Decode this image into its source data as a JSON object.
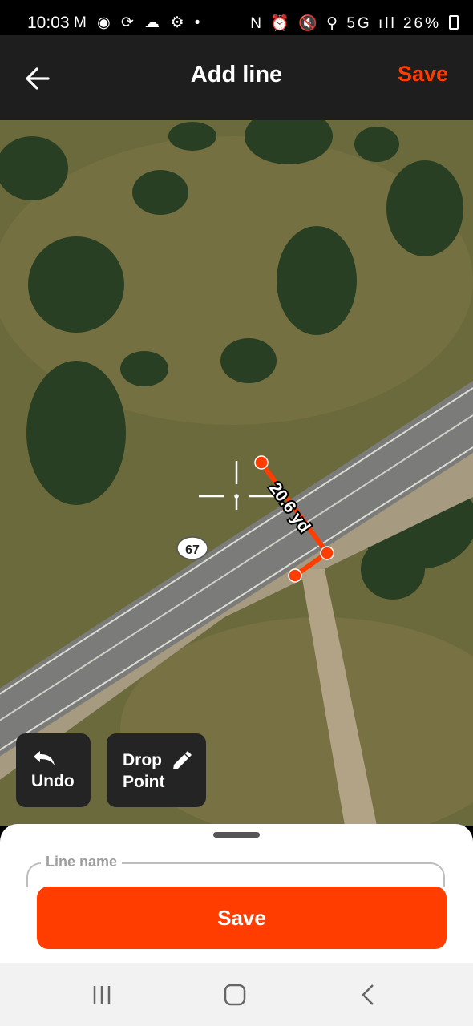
{
  "status_bar": {
    "time": "10:03",
    "notif_icons": "M ◉ ⟳ ☁ ⚙ •",
    "right_icons": "N ⏰ 🔇 ⚲ 5G ıll",
    "battery": "26%"
  },
  "header": {
    "title": "Add line",
    "save_label": "Save",
    "back_icon": "arrow-left-icon"
  },
  "map": {
    "route_label": "67",
    "measure_label": "20.6 yd",
    "line_color": "#ff3d00"
  },
  "controls": {
    "undo_label": "Undo",
    "drop_label_line1": "Drop",
    "drop_label_line2": "Point"
  },
  "sheet": {
    "field_label": "Line name",
    "field_value": "",
    "save_label": "Save"
  },
  "colors": {
    "accent": "#ff3d00",
    "header_bg": "#1e1e1e"
  }
}
